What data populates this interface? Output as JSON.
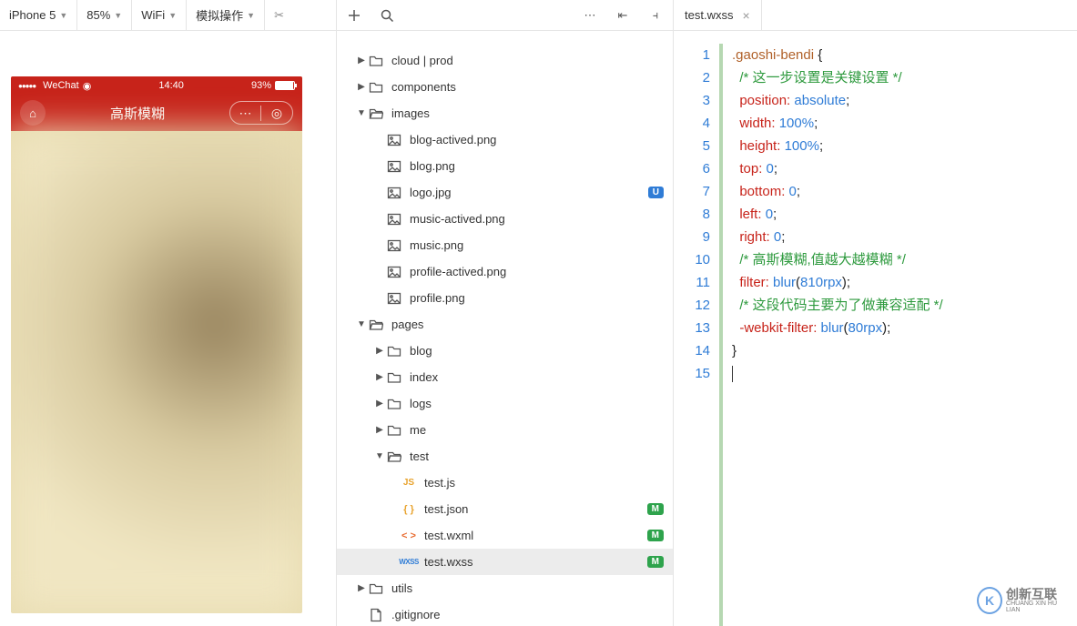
{
  "sim": {
    "device": "iPhone 5",
    "zoom": "85%",
    "network": "WiFi",
    "mock": "模拟操作",
    "status_carrier": "WeChat",
    "status_time": "14:40",
    "status_batt": "93%",
    "nav_title": "高斯模糊"
  },
  "tree": {
    "items": [
      {
        "depth": 0,
        "caret": "▶",
        "icon": "folder",
        "label": "cloud | prod",
        "badge": ""
      },
      {
        "depth": 0,
        "caret": "▶",
        "icon": "folder",
        "label": "components",
        "badge": ""
      },
      {
        "depth": 0,
        "caret": "▼",
        "icon": "folder-open",
        "label": "images",
        "badge": ""
      },
      {
        "depth": 1,
        "caret": "",
        "icon": "image",
        "label": "blog-actived.png",
        "badge": ""
      },
      {
        "depth": 1,
        "caret": "",
        "icon": "image",
        "label": "blog.png",
        "badge": ""
      },
      {
        "depth": 1,
        "caret": "",
        "icon": "image",
        "label": "logo.jpg",
        "badge": "U"
      },
      {
        "depth": 1,
        "caret": "",
        "icon": "image",
        "label": "music-actived.png",
        "badge": ""
      },
      {
        "depth": 1,
        "caret": "",
        "icon": "image",
        "label": "music.png",
        "badge": ""
      },
      {
        "depth": 1,
        "caret": "",
        "icon": "image",
        "label": "profile-actived.png",
        "badge": ""
      },
      {
        "depth": 1,
        "caret": "",
        "icon": "image",
        "label": "profile.png",
        "badge": ""
      },
      {
        "depth": 0,
        "caret": "▼",
        "icon": "folder-open",
        "label": "pages",
        "badge": ""
      },
      {
        "depth": 1,
        "caret": "▶",
        "icon": "folder",
        "label": "blog",
        "badge": ""
      },
      {
        "depth": 1,
        "caret": "▶",
        "icon": "folder",
        "label": "index",
        "badge": ""
      },
      {
        "depth": 1,
        "caret": "▶",
        "icon": "folder",
        "label": "logs",
        "badge": ""
      },
      {
        "depth": 1,
        "caret": "▶",
        "icon": "folder",
        "label": "me",
        "badge": ""
      },
      {
        "depth": 1,
        "caret": "▼",
        "icon": "folder-open",
        "label": "test",
        "badge": ""
      },
      {
        "depth": 2,
        "caret": "",
        "icon": "js",
        "label": "test.js",
        "badge": ""
      },
      {
        "depth": 2,
        "caret": "",
        "icon": "json",
        "label": "test.json",
        "badge": "M"
      },
      {
        "depth": 2,
        "caret": "",
        "icon": "wxml",
        "label": "test.wxml",
        "badge": "M"
      },
      {
        "depth": 2,
        "caret": "",
        "icon": "wxss",
        "label": "test.wxss",
        "badge": "M",
        "selected": true
      },
      {
        "depth": 0,
        "caret": "▶",
        "icon": "folder",
        "label": "utils",
        "badge": ""
      },
      {
        "depth": 0,
        "caret": "",
        "icon": "file",
        "label": ".gitignore",
        "badge": ""
      }
    ]
  },
  "editor": {
    "tab": "test.wxss",
    "line_numbers": [
      "1",
      "2",
      "3",
      "4",
      "5",
      "6",
      "7",
      "8",
      "9",
      "10",
      "11",
      "12",
      "13",
      "14",
      "15"
    ],
    "code": {
      "selector": ".gaoshi-bendi",
      "comment1": "/* 这一步设置是关键设置 */",
      "p_position": "position:",
      "v_position": "absolute",
      "p_width": "width:",
      "v_width": "100%",
      "p_height": "height:",
      "v_height": "100%",
      "p_top": "top:",
      "v_top": "0",
      "p_bottom": "bottom:",
      "v_bottom": "0",
      "p_left": "left:",
      "v_left": "0",
      "p_right": "right:",
      "v_right": "0",
      "comment2": "/* 高斯模糊,值越大越模糊 */",
      "p_filter": "filter:",
      "v_filter_fn": "blur",
      "v_filter_arg": "810rpx",
      "comment3": "/* 这段代码主要为了做兼容适配 */",
      "p_wfilter": "-webkit-filter:",
      "v_wfilter_fn": "blur",
      "v_wfilter_arg": "80rpx"
    }
  },
  "watermark": {
    "brand": "创新互联",
    "sub": "CHUANG XIN HU LIAN"
  }
}
